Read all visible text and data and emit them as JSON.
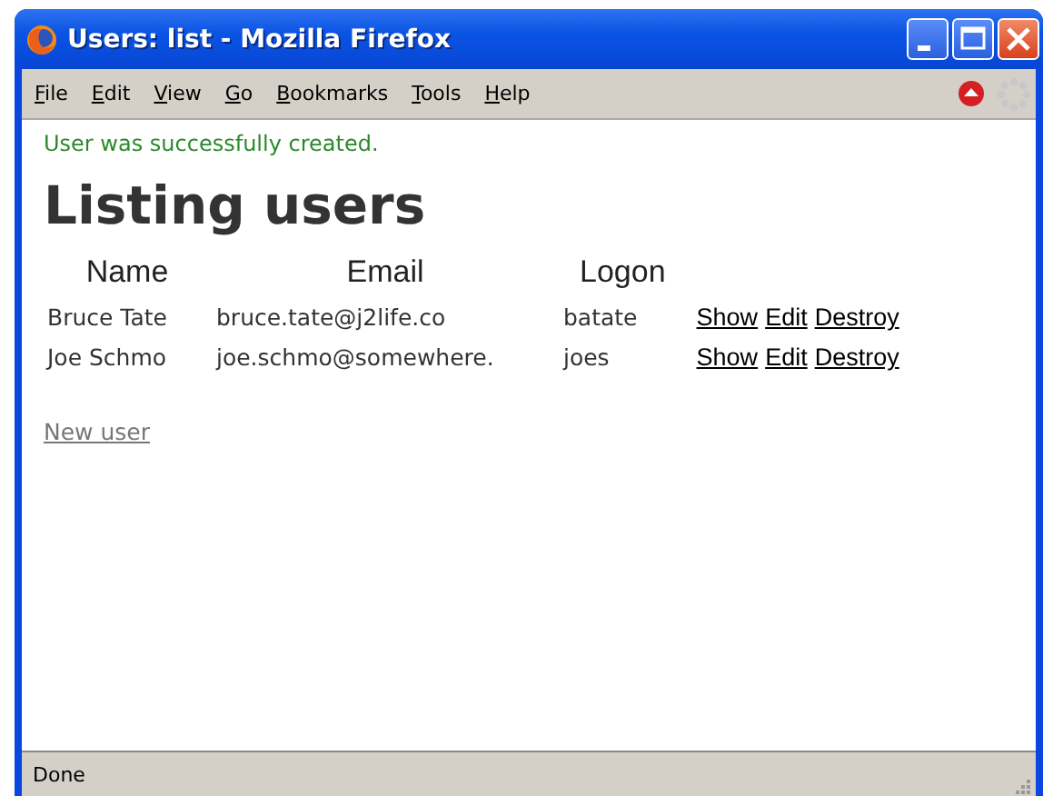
{
  "window": {
    "title": "Users: list - Mozilla Firefox"
  },
  "menu": [
    "File",
    "Edit",
    "View",
    "Go",
    "Bookmarks",
    "Tools",
    "Help"
  ],
  "notice": "User was successfully created.",
  "heading": "Listing users",
  "table": {
    "columns": [
      "Name",
      "Email",
      "Logon"
    ],
    "rows": [
      {
        "cells": [
          "Bruce Tate",
          "bruce.tate@j2life.co",
          "batate"
        ],
        "actions": [
          "Show",
          "Edit",
          "Destroy"
        ]
      },
      {
        "cells": [
          "Joe Schmo",
          "joe.schmo@somewhere.",
          "joes"
        ],
        "actions": [
          "Show",
          "Edit",
          "Destroy"
        ]
      }
    ]
  },
  "new_link": "New user",
  "status_bar": "Done"
}
